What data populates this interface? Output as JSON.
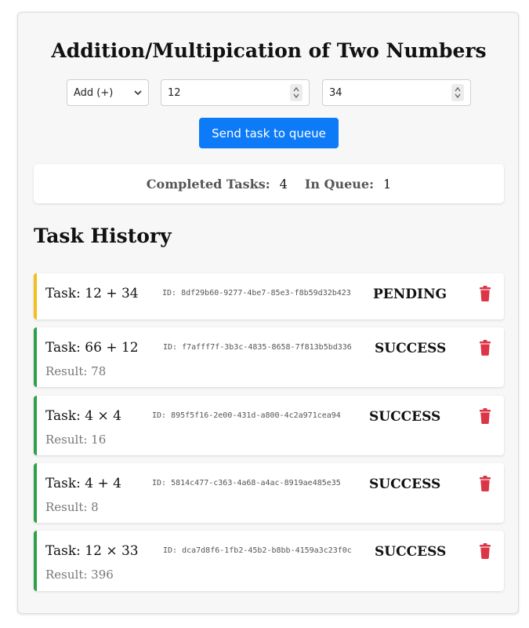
{
  "header": {
    "title": "Addition/Multipication of Two Numbers"
  },
  "form": {
    "operation": "Add (+)",
    "number1": "12",
    "number2": "34",
    "send_label": "Send task to queue"
  },
  "stats": {
    "completed_label": "Completed Tasks:",
    "completed_value": "4",
    "queue_label": "In Queue:",
    "queue_value": "1"
  },
  "history": {
    "title": "Task History",
    "tasks": [
      {
        "name": "Task: 12 + 34",
        "id": "ID: 8df29b60-9277-4be7-85e3-f8b59d32b423",
        "status": "PENDING",
        "result": ""
      },
      {
        "name": "Task: 66 + 12",
        "id": "ID: f7afff7f-3b3c-4835-8658-7f813b5bd336",
        "status": "SUCCESS",
        "result": "Result: 78"
      },
      {
        "name": "Task: 4 × 4",
        "id": "ID: 895f5f16-2e00-431d-a800-4c2a971cea94",
        "status": "SUCCESS",
        "result": "Result: 16"
      },
      {
        "name": "Task: 4 + 4",
        "id": "ID: 5814c477-c363-4a68-a4ac-8919ae485e35",
        "status": "SUCCESS",
        "result": "Result: 8"
      },
      {
        "name": "Task: 12 × 33",
        "id": "ID: dca7d8f6-1fb2-45b2-b8bb-4159a3c23f0c",
        "status": "SUCCESS",
        "result": "Result: 396"
      }
    ]
  },
  "colors": {
    "primary": "#0d7bf7",
    "pending": "#f2c01e",
    "success": "#2fa04a",
    "delete": "#dc3545"
  },
  "icons": {
    "delete": "trash-icon",
    "select": "chevron-down-icon",
    "spinner": "up-down-arrows-icon"
  }
}
